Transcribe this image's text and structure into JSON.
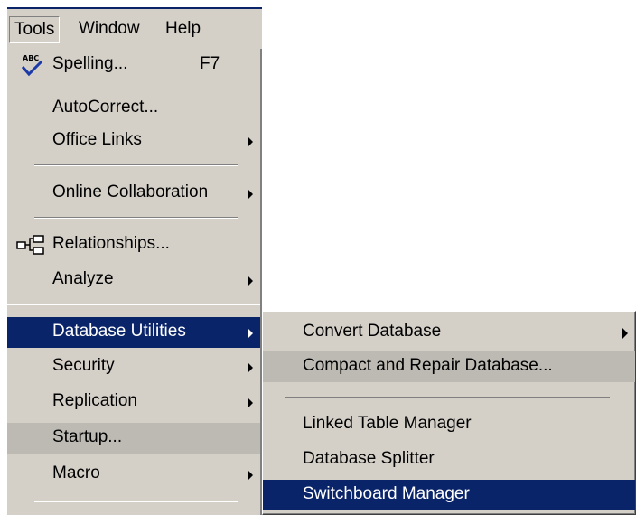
{
  "menubar": {
    "items": [
      {
        "label": "Tools",
        "name": "menubar-tools"
      },
      {
        "label": "Window",
        "name": "menubar-window"
      },
      {
        "label": "Help",
        "name": "menubar-help"
      }
    ]
  },
  "tools_menu": {
    "spelling": {
      "label": "Spelling...",
      "shortcut": "F7",
      "icon": "spelling-abc-check-icon"
    },
    "autocorrect": {
      "label": "AutoCorrect..."
    },
    "office_links": {
      "label": "Office Links"
    },
    "online_collab": {
      "label": "Online Collaboration"
    },
    "relationships": {
      "label": "Relationships...",
      "icon": "relationships-icon"
    },
    "analyze": {
      "label": "Analyze"
    },
    "database_utilities": {
      "label": "Database Utilities"
    },
    "security": {
      "label": "Security"
    },
    "replication": {
      "label": "Replication"
    },
    "startup": {
      "label": "Startup..."
    },
    "macro": {
      "label": "Macro"
    }
  },
  "submenu": {
    "convert_database": {
      "label": "Convert Database"
    },
    "compact_repair": {
      "label": "Compact and Repair Database..."
    },
    "linked_table_manager": {
      "label": "Linked Table Manager"
    },
    "database_splitter": {
      "label": "Database Splitter"
    },
    "switchboard_manager": {
      "label": "Switchboard Manager"
    }
  },
  "colors": {
    "menu_bg": "#d4d0c8",
    "highlight": "#0a246a",
    "highlight_text": "#ffffff"
  }
}
